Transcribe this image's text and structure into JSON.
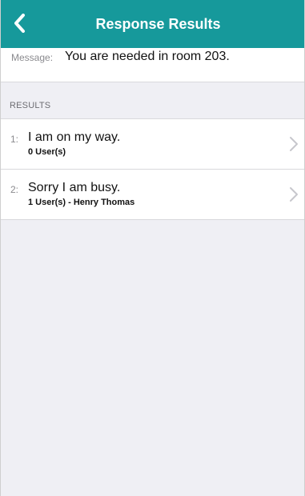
{
  "header": {
    "title": "Response Results",
    "back_icon": "chevron-left-icon"
  },
  "message": {
    "label": "Message:",
    "text": "You are needed in room 203."
  },
  "results": {
    "section_title": "RESULTS",
    "items": [
      {
        "index": "1:",
        "response": "I am on my way.",
        "summary": "0 User(s)"
      },
      {
        "index": "2:",
        "response": "Sorry I am busy.",
        "summary": "1 User(s) - Henry Thomas"
      }
    ],
    "row_icon": "chevron-right-icon"
  },
  "colors": {
    "header_bg": "#16999b",
    "page_bg": "#efeff4"
  }
}
